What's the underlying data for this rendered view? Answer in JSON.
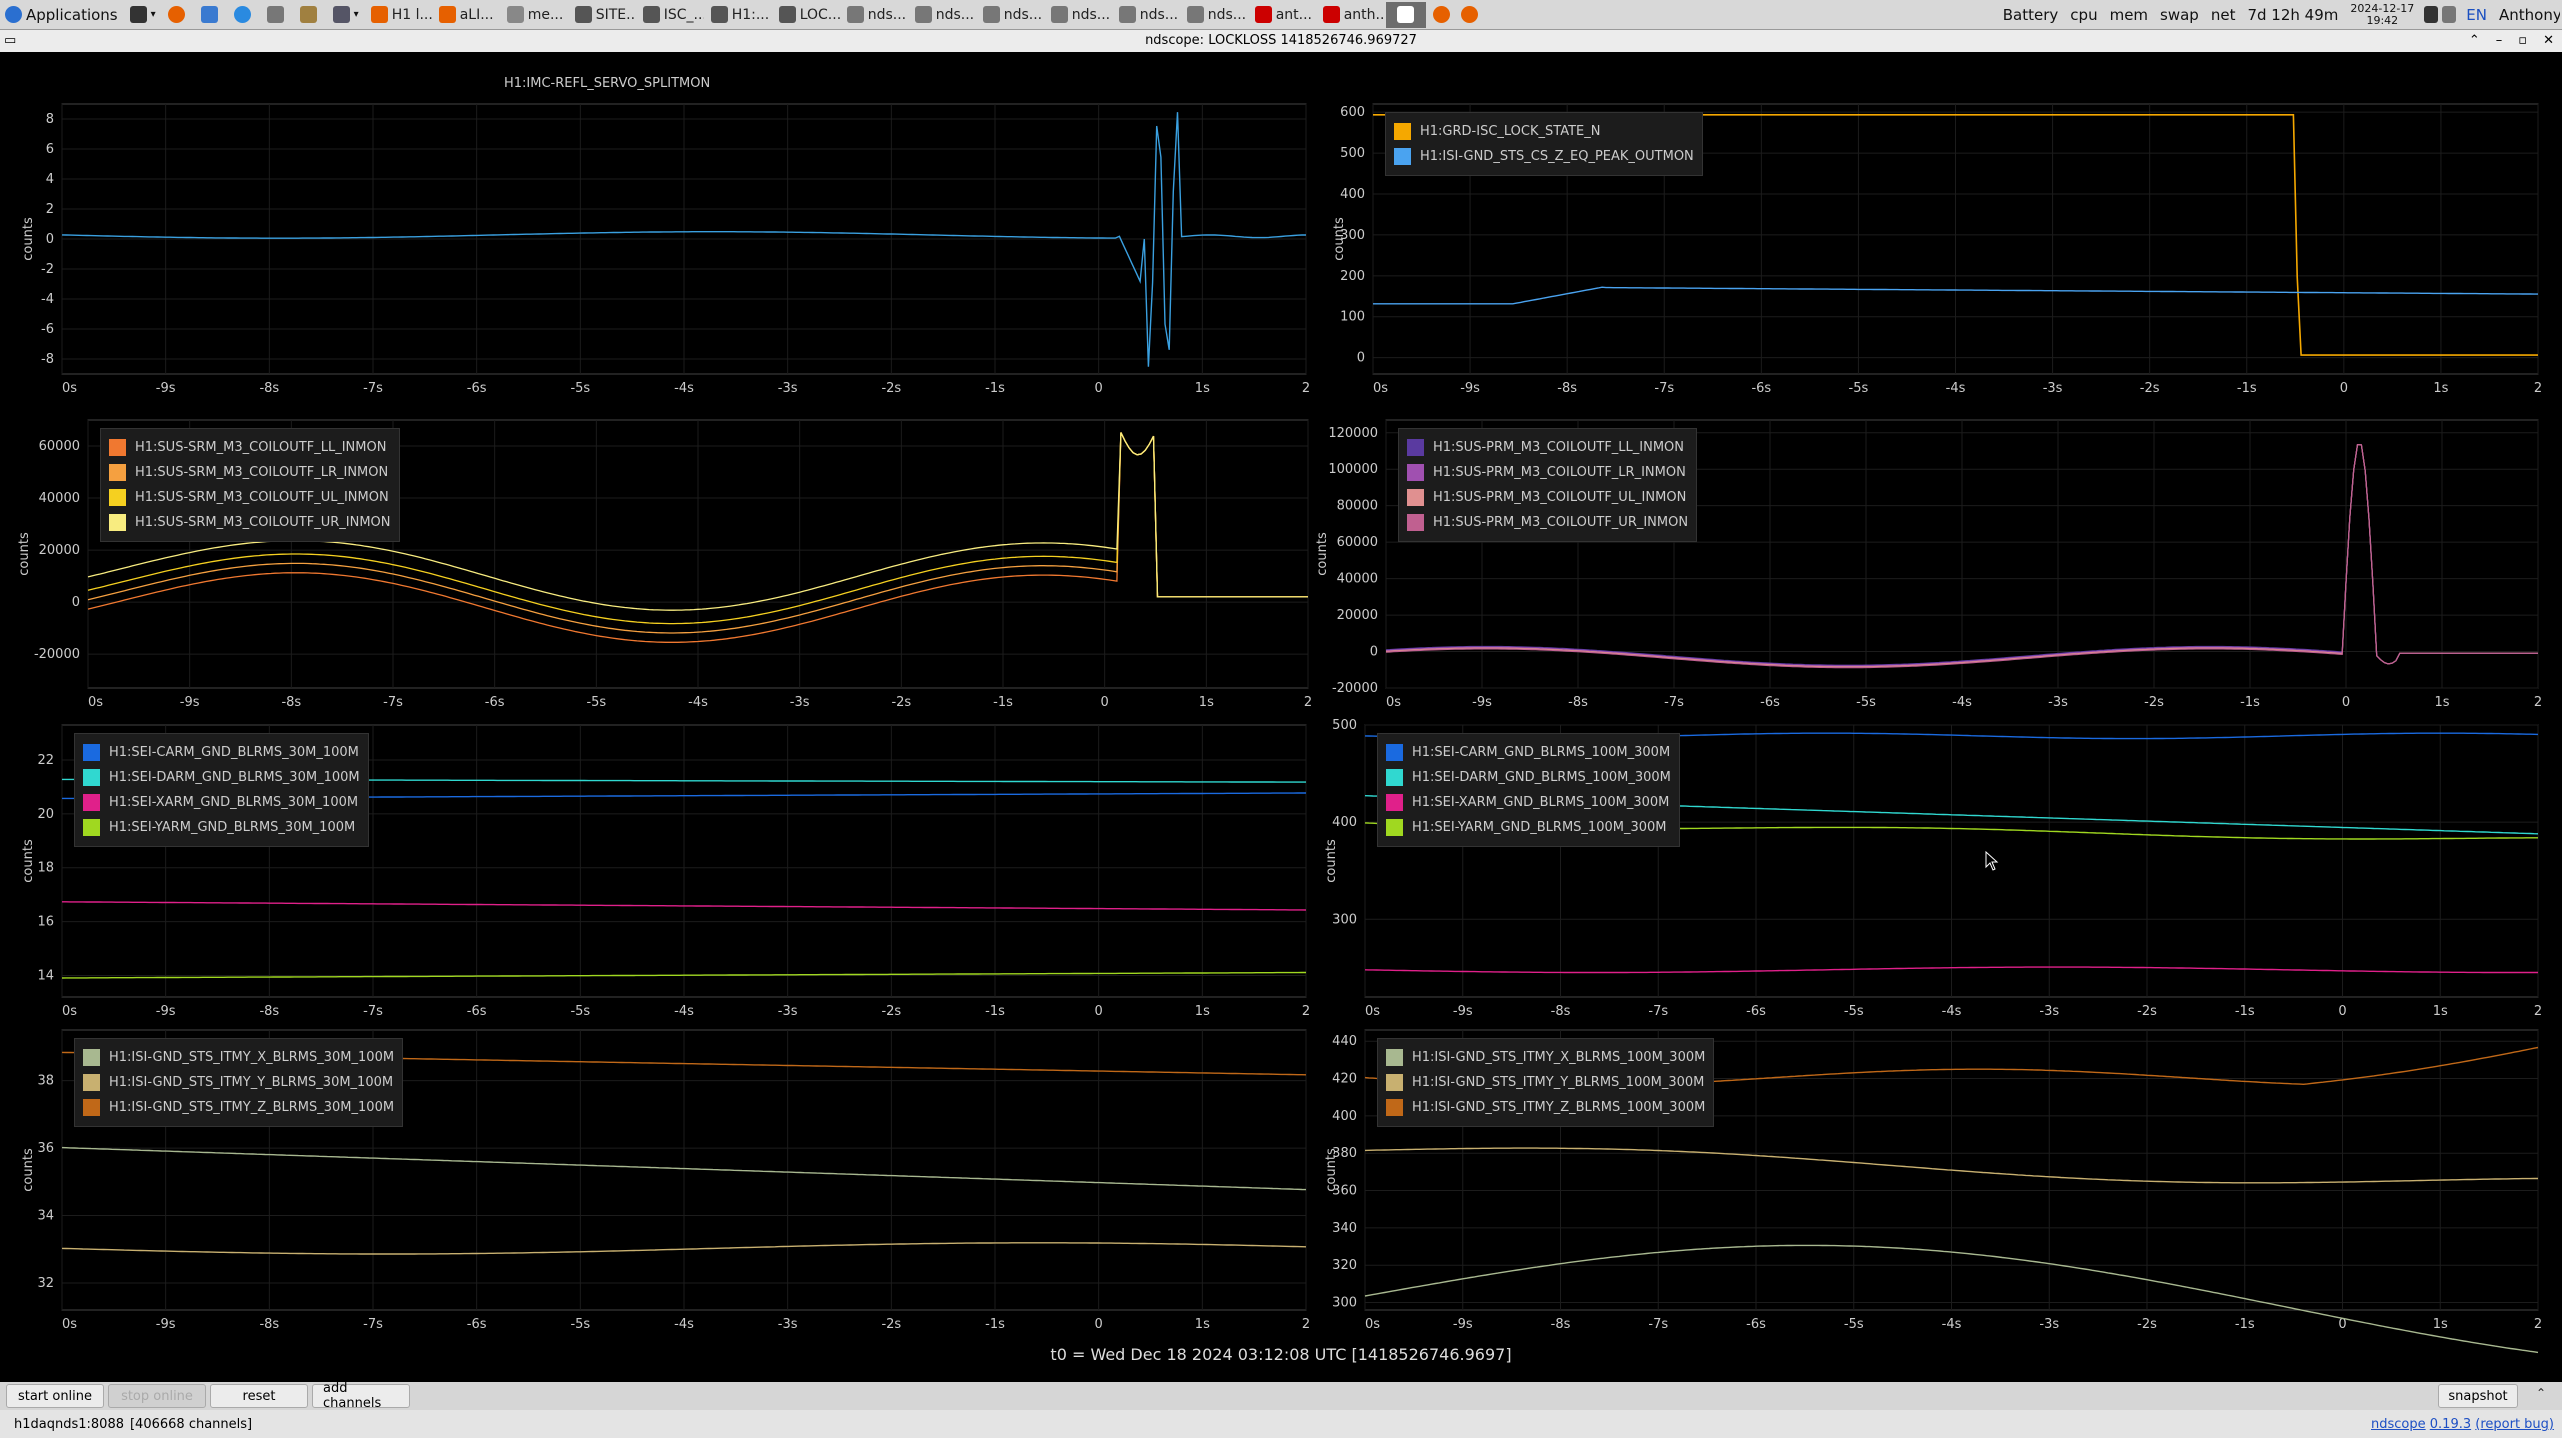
{
  "taskbar": {
    "apps_label": "Applications",
    "tasks": [
      {
        "label": "H1 l...",
        "icon": "firefox-icon",
        "color": "#e66000"
      },
      {
        "label": "aLI...",
        "icon": "firefox-icon",
        "color": "#e66000"
      },
      {
        "label": "me...",
        "icon": "window-icon",
        "color": "#888"
      },
      {
        "label": "SITE...",
        "icon": "terminal-icon",
        "color": "#555"
      },
      {
        "label": "ISC_...",
        "icon": "terminal-icon",
        "color": "#555"
      },
      {
        "label": "H1:...",
        "icon": "terminal-icon",
        "color": "#555"
      },
      {
        "label": "LOC...",
        "icon": "terminal-icon",
        "color": "#555"
      },
      {
        "label": "nds...",
        "icon": "window-icon",
        "color": "#777"
      },
      {
        "label": "nds...",
        "icon": "window-icon",
        "color": "#777"
      },
      {
        "label": "nds...",
        "icon": "window-icon",
        "color": "#777"
      },
      {
        "label": "nds...",
        "icon": "window-icon",
        "color": "#777"
      },
      {
        "label": "nds...",
        "icon": "window-icon",
        "color": "#777"
      },
      {
        "label": "nds...",
        "icon": "window-icon",
        "color": "#777"
      },
      {
        "label": "ant...",
        "icon": "pdf-icon",
        "color": "#c00"
      },
      {
        "label": "anth...",
        "icon": "pdf-icon",
        "color": "#c00"
      }
    ],
    "battery": "Battery",
    "cpu": "cpu",
    "mem": "mem",
    "swap": "swap",
    "net": "net",
    "uptime": "7d 12h 49m",
    "date": "2024-12-17",
    "time": "19:42",
    "lang": "EN",
    "user": "Anthony Sanchez"
  },
  "window": {
    "title": "ndscope: LOCKLOSS 1418526746.969727"
  },
  "x_ticks": [
    "0s",
    "-9s",
    "-8s",
    "-7s",
    "-6s",
    "-5s",
    "-4s",
    "-3s",
    "-2s",
    "-1s",
    "0",
    "1s",
    "2"
  ],
  "y_unit": "counts",
  "plots": [
    {
      "id": "p1",
      "title": "H1:IMC-REFL_SERVO_SPLITMON",
      "yticks": [
        "8",
        "6",
        "4",
        "2",
        "0",
        "-2",
        "-4",
        "-6",
        "-8"
      ],
      "legend": []
    },
    {
      "id": "p2",
      "title": "",
      "yticks": [
        "600",
        "500",
        "400",
        "300",
        "200",
        "100",
        "0"
      ],
      "legend": [
        {
          "label": "H1:GRD-ISC_LOCK_STATE_N",
          "color": "#f5a800"
        },
        {
          "label": "H1:ISI-GND_STS_CS_Z_EQ_PEAK_OUTMON",
          "color": "#4aa3f0"
        }
      ]
    },
    {
      "id": "p3",
      "title": "",
      "yticks": [
        "60000",
        "40000",
        "20000",
        "0",
        "-20000"
      ],
      "legend": [
        {
          "label": "H1:SUS-SRM_M3_COILOUTF_LL_INMON",
          "color": "#f07830"
        },
        {
          "label": "H1:SUS-SRM_M3_COILOUTF_LR_INMON",
          "color": "#f5a040"
        },
        {
          "label": "H1:SUS-SRM_M3_COILOUTF_UL_INMON",
          "color": "#f5d020"
        },
        {
          "label": "H1:SUS-SRM_M3_COILOUTF_UR_INMON",
          "color": "#f8ec80"
        }
      ]
    },
    {
      "id": "p4",
      "title": "",
      "yticks": [
        "120000",
        "100000",
        "80000",
        "60000",
        "40000",
        "20000",
        "0",
        "-20000"
      ],
      "legend": [
        {
          "label": "H1:SUS-PRM_M3_COILOUTF_LL_INMON",
          "color": "#5a3aa0"
        },
        {
          "label": "H1:SUS-PRM_M3_COILOUTF_LR_INMON",
          "color": "#a050b0"
        },
        {
          "label": "H1:SUS-PRM_M3_COILOUTF_UL_INMON",
          "color": "#e09090"
        },
        {
          "label": "H1:SUS-PRM_M3_COILOUTF_UR_INMON",
          "color": "#c06090"
        }
      ]
    },
    {
      "id": "p5",
      "title": "",
      "yticks": [
        "22",
        "20",
        "18",
        "16",
        "14"
      ],
      "legend": [
        {
          "label": "H1:SEI-CARM_GND_BLRMS_30M_100M",
          "color": "#1a6ae0"
        },
        {
          "label": "H1:SEI-DARM_GND_BLRMS_30M_100M",
          "color": "#30d8d0"
        },
        {
          "label": "H1:SEI-XARM_GND_BLRMS_30M_100M",
          "color": "#e0208a"
        },
        {
          "label": "H1:SEI-YARM_GND_BLRMS_30M_100M",
          "color": "#a0d820"
        }
      ]
    },
    {
      "id": "p6",
      "title": "",
      "yticks": [
        "500",
        "400",
        "300"
      ],
      "legend": [
        {
          "label": "H1:SEI-CARM_GND_BLRMS_100M_300M",
          "color": "#1a6ae0"
        },
        {
          "label": "H1:SEI-DARM_GND_BLRMS_100M_300M",
          "color": "#30d8d0"
        },
        {
          "label": "H1:SEI-XARM_GND_BLRMS_100M_300M",
          "color": "#e0208a"
        },
        {
          "label": "H1:SEI-YARM_GND_BLRMS_100M_300M",
          "color": "#a0d820"
        }
      ]
    },
    {
      "id": "p7",
      "title": "",
      "yticks": [
        "38",
        "36",
        "34",
        "32"
      ],
      "legend": [
        {
          "label": "H1:ISI-GND_STS_ITMY_X_BLRMS_30M_100M",
          "color": "#a8b890"
        },
        {
          "label": "H1:ISI-GND_STS_ITMY_Y_BLRMS_30M_100M",
          "color": "#c8b070"
        },
        {
          "label": "H1:ISI-GND_STS_ITMY_Z_BLRMS_30M_100M",
          "color": "#c06818"
        }
      ]
    },
    {
      "id": "p8",
      "title": "",
      "yticks": [
        "440",
        "420",
        "400",
        "380",
        "360",
        "340",
        "320",
        "300"
      ],
      "legend": [
        {
          "label": "H1:ISI-GND_STS_ITMY_X_BLRMS_100M_300M",
          "color": "#a8b890"
        },
        {
          "label": "H1:ISI-GND_STS_ITMY_Y_BLRMS_100M_300M",
          "color": "#c8b070"
        },
        {
          "label": "H1:ISI-GND_STS_ITMY_Z_BLRMS_100M_300M",
          "color": "#c06818"
        }
      ]
    }
  ],
  "t0_label": "t0 = Wed Dec 18 2024 03:12:08 UTC [1418526746.9697]",
  "buttons": {
    "start_online": "start online",
    "stop_online": "stop online",
    "reset": "reset",
    "add_channels": "add channels",
    "snapshot": "snapshot"
  },
  "status": {
    "server": "h1daqnds1:8088",
    "channels": "[406668 channels]",
    "app_name": "ndscope",
    "version": "0.19.3",
    "report_bug": "(report bug)"
  }
}
